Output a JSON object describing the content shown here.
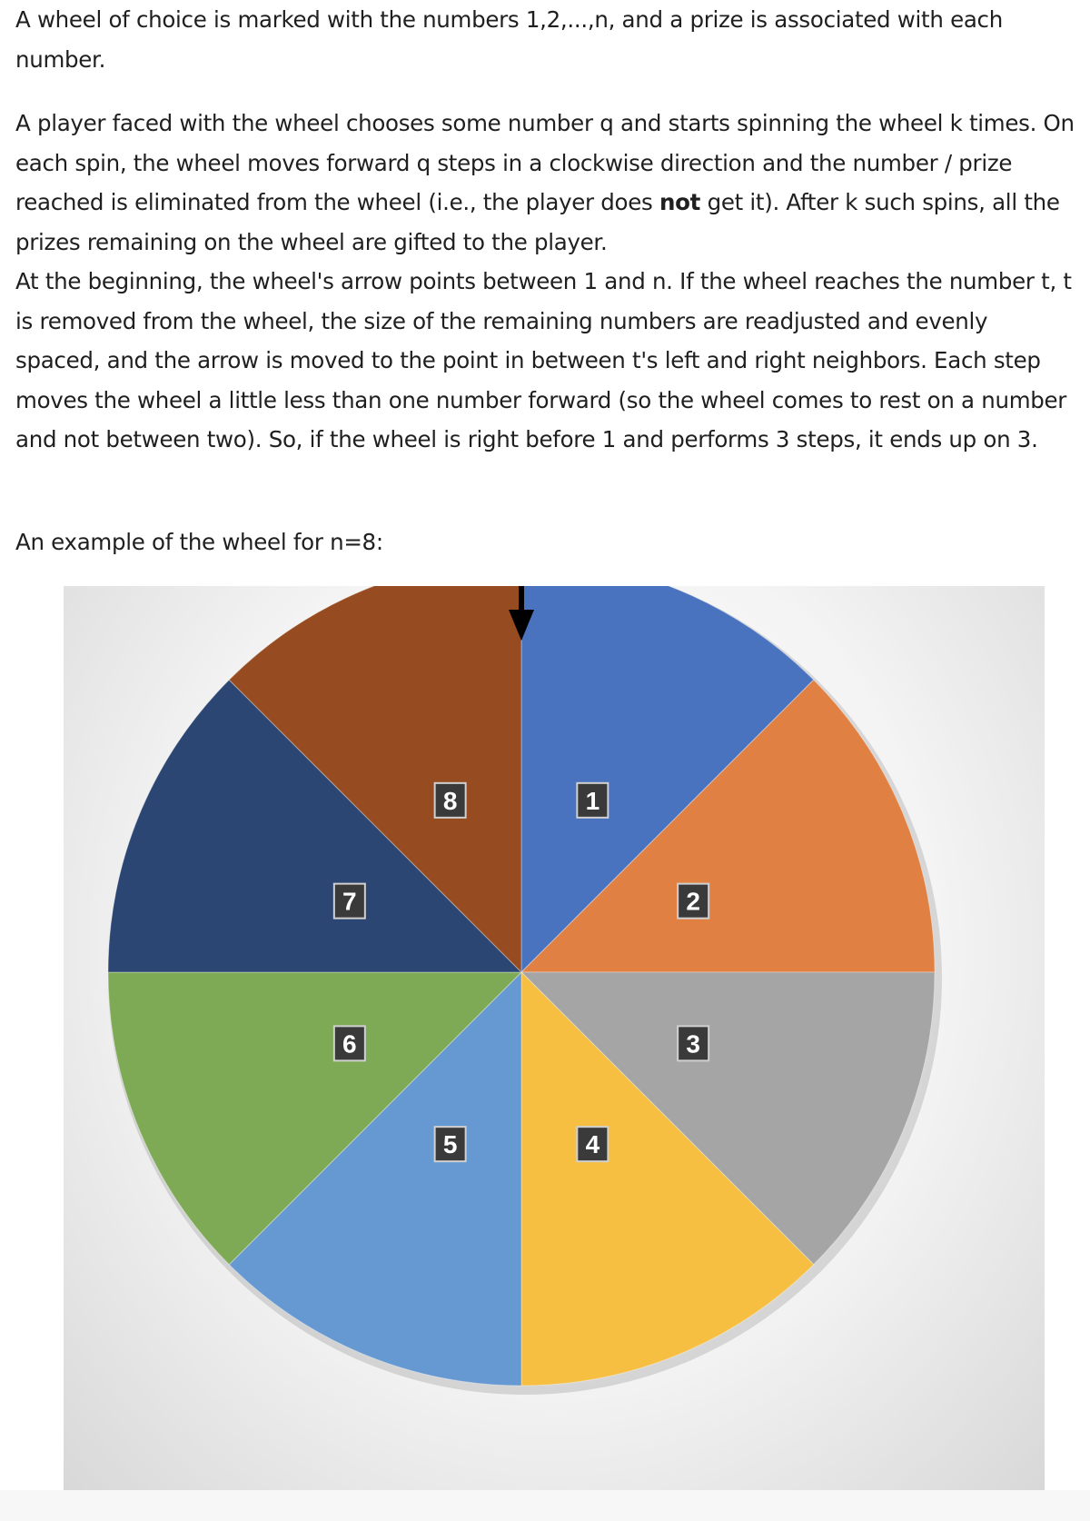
{
  "paragraphs": {
    "intro": "A wheel of choice is marked with the numbers 1,2,...,n, and a prize is associated with each number.",
    "rules_part1": "A player faced with the wheel chooses some number q and starts spinning the wheel k times. On each spin, the wheel moves forward q steps in a clockwise direction and the number / prize reached is eliminated from the wheel (i.e., the player does ",
    "rules_bold": "not",
    "rules_part2": " get it). After k such spins, all the prizes remaining on the wheel are gifted to the player.",
    "rules_part3": "At the beginning, the wheel's arrow points between 1 and n. If the wheel reaches the number t, t is removed from the wheel, the size of the remaining numbers are readjusted and evenly spaced, and the arrow is moved to the point in between t's left and right neighbors. Each step moves the wheel a little less than one number forward (so the wheel comes to rest on a number and not between two). So, if the wheel is right before 1 and performs 3 steps, it ends up on 3.",
    "example": "An example of the wheel for n=8:"
  },
  "wheel": {
    "slices": [
      {
        "label": "1",
        "color": "#4a73bf"
      },
      {
        "label": "2",
        "color": "#e08143"
      },
      {
        "label": "3",
        "color": "#a5a5a5"
      },
      {
        "label": "4",
        "color": "#f6bf41"
      },
      {
        "label": "5",
        "color": "#6699d1"
      },
      {
        "label": "6",
        "color": "#7eaa55"
      },
      {
        "label": "7",
        "color": "#2c4673"
      },
      {
        "label": "8",
        "color": "#974b20"
      }
    ],
    "arrow_color": "#000000",
    "label_box_color": "#3a3a3a"
  }
}
